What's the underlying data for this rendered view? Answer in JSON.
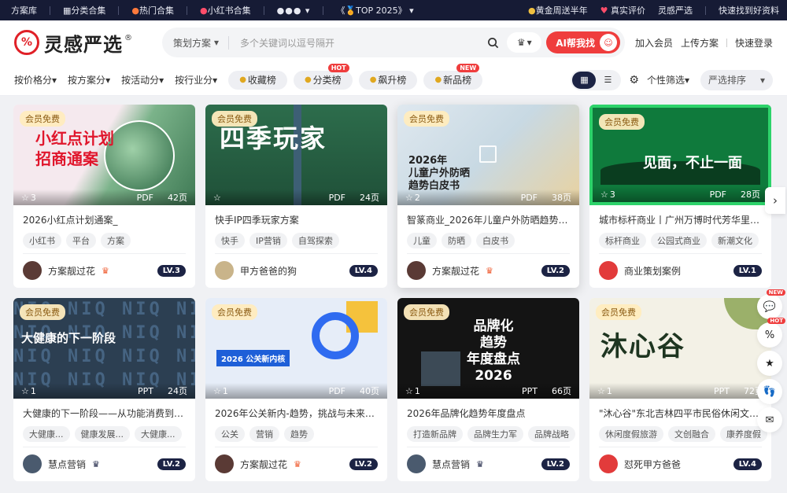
{
  "topbar": {
    "left": [
      "方案库",
      "分类合集",
      "热门合集",
      "小红书合集"
    ],
    "more": "●●●",
    "top_label": "《🏅TOP 2025》",
    "right": [
      "黄金周送半年",
      "真实评价",
      "灵感严选",
      "快速找到好资料"
    ]
  },
  "header": {
    "logo_text": "灵感严选",
    "logo_reg": "®",
    "search_scope": "策划方案",
    "search_placeholder": "多个关键词以逗号隔开",
    "ai_button": "AI帮我找",
    "links": [
      "加入会员",
      "上传方案",
      "快速登录"
    ]
  },
  "filters": {
    "selects": [
      "按价格分",
      "按方案分",
      "按活动分",
      "按行业分"
    ],
    "pills": [
      {
        "label": "收藏榜",
        "badge": ""
      },
      {
        "label": "分类榜",
        "badge": "HOT"
      },
      {
        "label": "飙升榜",
        "badge": ""
      },
      {
        "label": "新品榜",
        "badge": "NEW"
      }
    ],
    "personal_filter": "个性筛选",
    "sort": "严选排序"
  },
  "cards": [
    {
      "free": "会员免费",
      "thumb_text": "小红点计划\n招商通案",
      "favs": "3",
      "type": "PDF",
      "pages": "42页",
      "title": "2026小红点计划通案_",
      "tags": [
        "小红书",
        "平台",
        "方案"
      ],
      "author": "方案靓过花",
      "level": "LV.3",
      "crown": true
    },
    {
      "free": "会员免费",
      "thumb_text": "四季玩家",
      "favs": "",
      "type": "PDF",
      "pages": "24页",
      "title": "快手IP四季玩家方案",
      "tags": [
        "快手",
        "IP营销",
        "自驾探索"
      ],
      "author": "甲方爸爸的狗",
      "level": "LV.4",
      "crown": false
    },
    {
      "free": "会员免费",
      "thumb_text": "2026年\n儿童户外防晒\n趋势白皮书",
      "favs": "2",
      "type": "PDF",
      "pages": "38页",
      "title": "智篆商业_2026年儿童户外防晒趋势白...",
      "tags": [
        "儿童",
        "防晒",
        "白皮书"
      ],
      "author": "方案靓过花",
      "level": "LV.2",
      "crown": true
    },
    {
      "free": "会员免费",
      "thumb_text": "见面，不止一面",
      "favs": "3",
      "type": "PDF",
      "pages": "28页",
      "title": "城市标杆商业丨广州万博时代芳华里C...",
      "tags": [
        "标杆商业",
        "公园式商业",
        "新潮文化"
      ],
      "author": "商业策划案例",
      "level": "LV.1",
      "crown": false
    },
    {
      "free": "会员免费",
      "thumb_text": "大健康的下一阶段",
      "favs": "1",
      "type": "PPT",
      "pages": "24页",
      "title": "大健康的下一阶段——从功能消费到意...",
      "tags": [
        "大健康...",
        "健康发展...",
        "大健康..."
      ],
      "author": "慧点营销",
      "level": "LV.2",
      "crown": true
    },
    {
      "free": "会员免费",
      "thumb_text": "2026 公关新内核",
      "favs": "1",
      "type": "PDF",
      "pages": "40页",
      "title": "2026年公关新内-趋势，挑战与未来展...",
      "tags": [
        "公关",
        "营销",
        "趋势"
      ],
      "author": "方案靓过花",
      "level": "LV.2",
      "crown": true
    },
    {
      "free": "会员免费",
      "thumb_text": "品牌化\n趋势\n年度盘点\n2026",
      "favs": "1",
      "type": "PPT",
      "pages": "66页",
      "title": "2026年品牌化趋势年度盘点",
      "tags": [
        "打造新品牌",
        "品牌生力军",
        "品牌战略"
      ],
      "author": "慧点营销",
      "level": "LV.2",
      "crown": true
    },
    {
      "free": "会员免费",
      "thumb_text": "沐心谷",
      "favs": "1",
      "type": "PPT",
      "pages": "72页",
      "title": "\"沐心谷\"东北吉林四平市民俗休闲文旅...",
      "tags": [
        "休闲度假旅游",
        "文创融合",
        "康养度假"
      ],
      "author": "怼死甲方爸爸",
      "level": "LV.4",
      "crown": false
    }
  ],
  "dock": {
    "badges": [
      "NEW",
      "HOT"
    ]
  },
  "colors": {
    "accent": "#ef3d3d",
    "dark": "#1c2344",
    "topbar": "#161b35"
  }
}
